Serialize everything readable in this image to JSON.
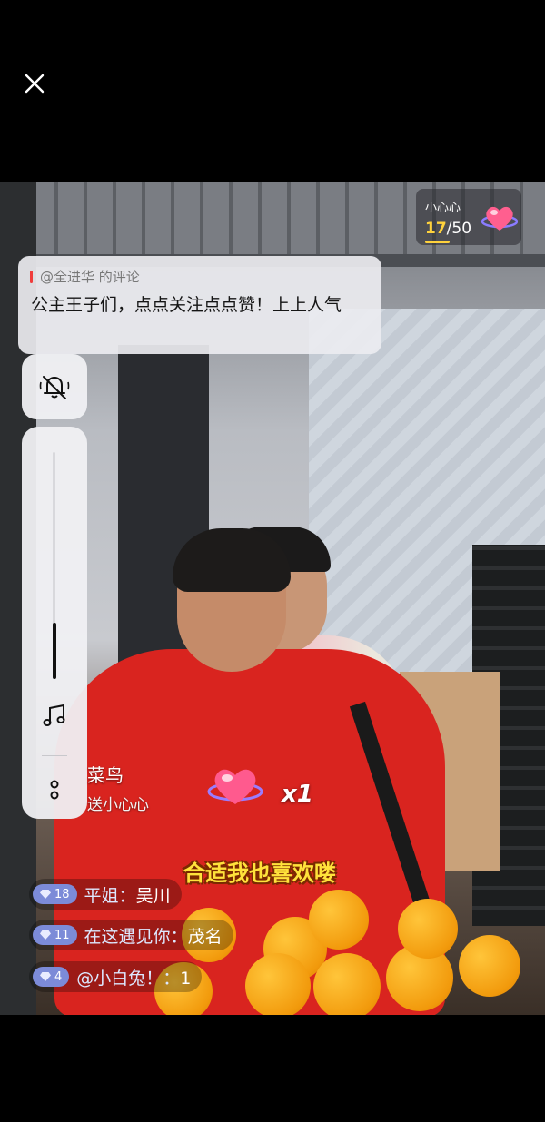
{
  "top": {
    "close_icon": "close-icon"
  },
  "heart_badge": {
    "label": "小心心",
    "current": "17",
    "total": "/50",
    "progress_fraction": 0.34
  },
  "pinned_comment": {
    "from": "@全进华 的评论",
    "text": "公主王子们，点点关注点点赞！上上人气"
  },
  "side_controls": {
    "mute_icon": "bell-muted-icon",
    "volume_level": 0.25,
    "music_icon": "music-note-icon",
    "more_icon": "more-dots-icon"
  },
  "gift": {
    "user": "菜鸟",
    "action": "送小心心",
    "multiplier": "x1"
  },
  "caption": "合适我也喜欢喽",
  "chat": [
    {
      "level": "18",
      "user": "平姐：",
      "text": "吴川"
    },
    {
      "level": "11",
      "user": "在这遇见你：",
      "text": "茂名"
    },
    {
      "level": "4",
      "user": "@小白兔！：",
      "text": "1"
    }
  ],
  "colors": {
    "accent_yellow": "#ffd23c",
    "level_badge": "#7c8bd8",
    "pin_bar": "#f03c3c"
  }
}
